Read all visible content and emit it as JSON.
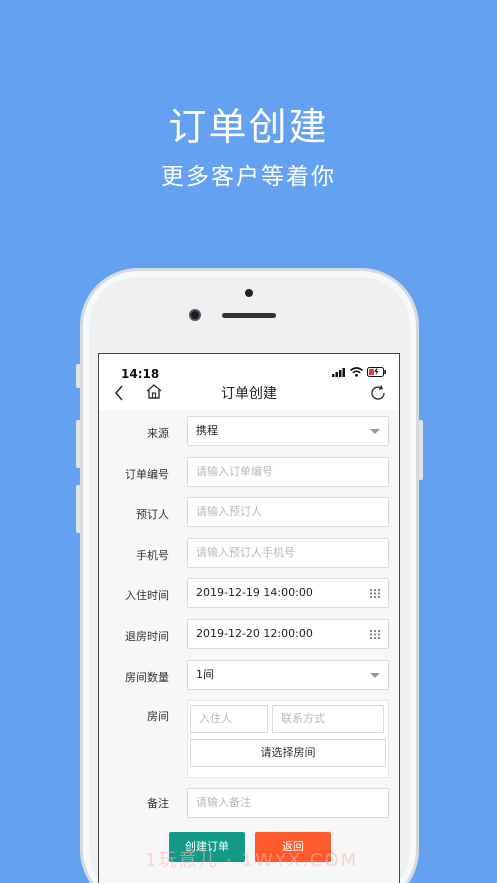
{
  "promo": {
    "title": "订单创建",
    "subtitle": "更多客户等着你"
  },
  "status_bar": {
    "time": "14:18"
  },
  "nav": {
    "title": "订单创建"
  },
  "form": {
    "source": {
      "label": "来源",
      "value": "携程"
    },
    "order_no": {
      "label": "订单编号",
      "placeholder": "请输入订单编号"
    },
    "booker": {
      "label": "预订人",
      "placeholder": "请输入预订人"
    },
    "phone": {
      "label": "手机号",
      "placeholder": "请输入预订人手机号"
    },
    "checkin": {
      "label": "入住时间",
      "value": "2019-12-19 14:00:00"
    },
    "checkout": {
      "label": "退房时间",
      "value": "2019-12-20 12:00:00"
    },
    "room_count": {
      "label": "房间数量",
      "value": "1间"
    },
    "room": {
      "label": "房间",
      "guest_placeholder": "入住人",
      "contact_placeholder": "联系方式",
      "select_label": "请选择房间"
    },
    "remark": {
      "label": "备注",
      "placeholder": "请输入备注"
    }
  },
  "buttons": {
    "create": "创建订单",
    "back": "返回"
  },
  "watermark": "1玩意儿 · 1WYX.COM",
  "colors": {
    "background": "#64a2f1",
    "create_button": "#139a86",
    "back_button": "#ff5a2b"
  }
}
